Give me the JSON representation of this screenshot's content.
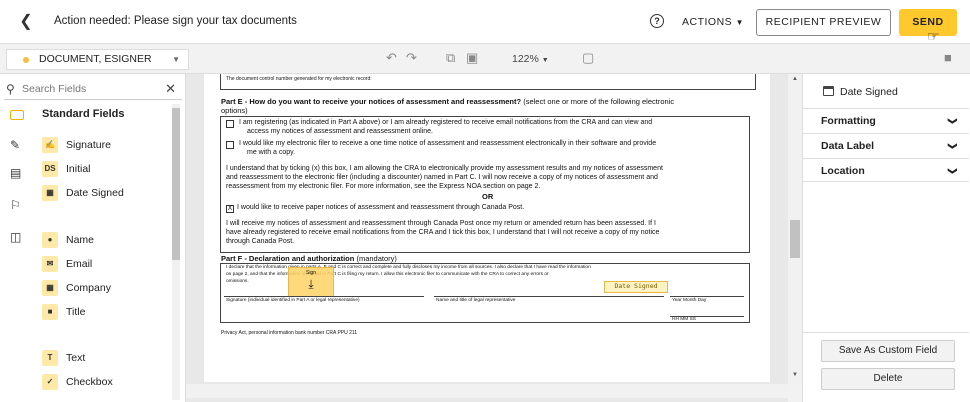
{
  "header": {
    "title": "Action needed: Please sign your tax documents",
    "actions": "ACTIONS",
    "recipient_preview": "RECIPIENT PREVIEW",
    "send": "SEND"
  },
  "toolbar": {
    "doc_select": "DOCUMENT, ESIGNER",
    "zoom": "122%"
  },
  "left": {
    "search_placeholder": "Search Fields",
    "section": "Standard Fields",
    "fields": [
      "Signature",
      "Initial",
      "Date Signed",
      "Name",
      "Email",
      "Company",
      "Title",
      "Text",
      "Checkbox"
    ]
  },
  "right": {
    "selected": "Date Signed",
    "formatting": "Formatting",
    "data_label": "Data Label",
    "location": "Location",
    "save_custom": "Save As Custom Field",
    "delete": "Delete"
  },
  "doc": {
    "top_line": "The document control number generated for my electronic record:",
    "partE": "Part E - How do you want to receive your notices of assessment and reassessment?",
    "partE_sub": " (select one or more of the following electronic",
    "options": "options)",
    "opt1a": "I am registering (as indicated in Part A above) or I am already registered to receive email notifications from the CRA and can view and",
    "opt1b": "access my notices of assessment and reassessment online.",
    "opt2a": "I would like my electronic filer to receive a one time notice of assessment and reassessment electronically in their software and provide",
    "opt2b": "me with a copy.",
    "para1a": "I understand that by ticking (x) this box, I am allowing the CRA to electronically provide my assessment results and my notices of assessment",
    "para1b": "and reassessment to the electronic filer (including a discounter) named in Part C. I will now receive a copy of my notices of assessment and",
    "para1c": "reassessment from my electronic filer. For more information, see the Express NOA section on page 2.",
    "or": "OR",
    "paper_x": "X",
    "paper": "I would like to receive paper notices of assessment and reassessment through Canada Post.",
    "para2a": "I will receive my notices of assessment and reassessment through Canada Post once my return or amended return has been assessed. If I",
    "para2b": "have already registered to receive email notifications from the CRA and I tick this box, I understand that I will not receive a copy of my notice",
    "para2c": "through Canada Post.",
    "partF": "Part F - Declaration and authorization",
    "partF_sub": " (mandatory)",
    "decl1": "I declare that the information given in parts A, B and C is correct and complete and fully discloses my income from all sources. I also declare that I have read the information",
    "decl2": "on page 2, and that the information identified in Part C is filing my return. I allow this electronic filer to communicate with the CRA to correct any errors or",
    "decl3": "omissions.",
    "sign_label": "Sign",
    "date_field": "Date Signed",
    "sig_caption": "Signature (individual identified in Part A or legal representative)",
    "name_caption": "Name and title of legal representative",
    "date_caption": "Year Month Day",
    "time_caption": "HH  MM  SS",
    "privacy": "Privacy Act, personal information bank number CRA PPU 211"
  }
}
